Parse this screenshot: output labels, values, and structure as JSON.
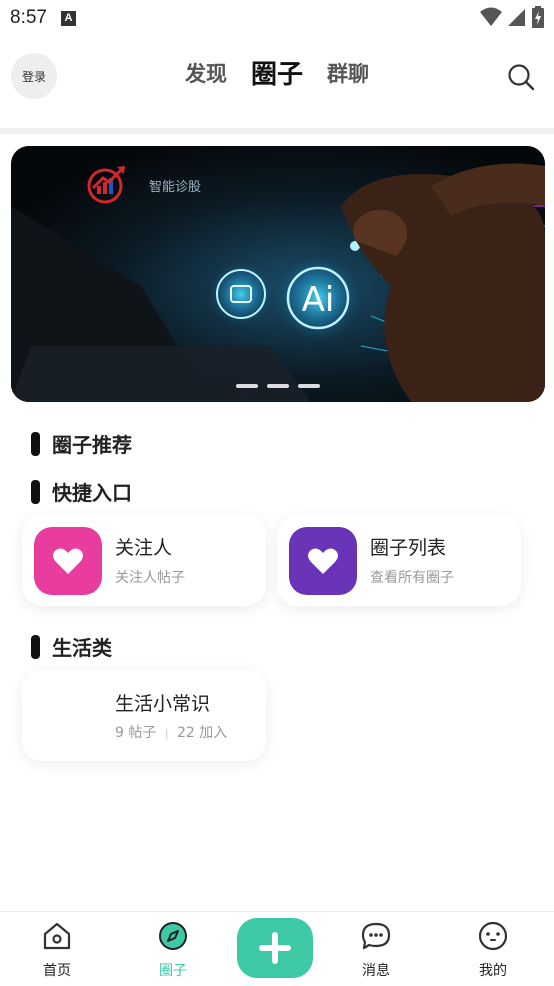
{
  "status_bar": {
    "time": "8:57",
    "notification_letter": "A"
  },
  "header": {
    "login_label": "登录",
    "tabs": [
      {
        "label": "发现",
        "active": false
      },
      {
        "label": "圈子",
        "active": true
      },
      {
        "label": "群聊",
        "active": false
      }
    ],
    "search_icon": "search-icon"
  },
  "banner": {
    "caption": "智能诊股",
    "ai_text": "Ai",
    "slide_count": 3
  },
  "sections": {
    "recommend_title": "圈子推荐",
    "shortcuts_title": "快捷入口",
    "life_title": "生活类"
  },
  "shortcuts": [
    {
      "title": "关注人",
      "subtitle": "关注人帖子",
      "icon": "heart-icon",
      "color": "#e83c9f"
    },
    {
      "title": "圈子列表",
      "subtitle": "查看所有圈子",
      "icon": "heart-icon",
      "color": "#6a34b8"
    }
  ],
  "life_circle": {
    "title": "生活小常识",
    "posts": "9 帖子",
    "separator": "|",
    "joined": "22 加入"
  },
  "bottom_nav": {
    "items": [
      {
        "label": "首页",
        "icon": "home-icon",
        "active": false
      },
      {
        "label": "圈子",
        "icon": "compass-icon",
        "active": true
      },
      {
        "label": "消息",
        "icon": "chat-icon",
        "active": false
      },
      {
        "label": "我的",
        "icon": "face-icon",
        "active": false
      }
    ],
    "plus_icon": "plus-icon",
    "accent": "#3ec9a6"
  }
}
